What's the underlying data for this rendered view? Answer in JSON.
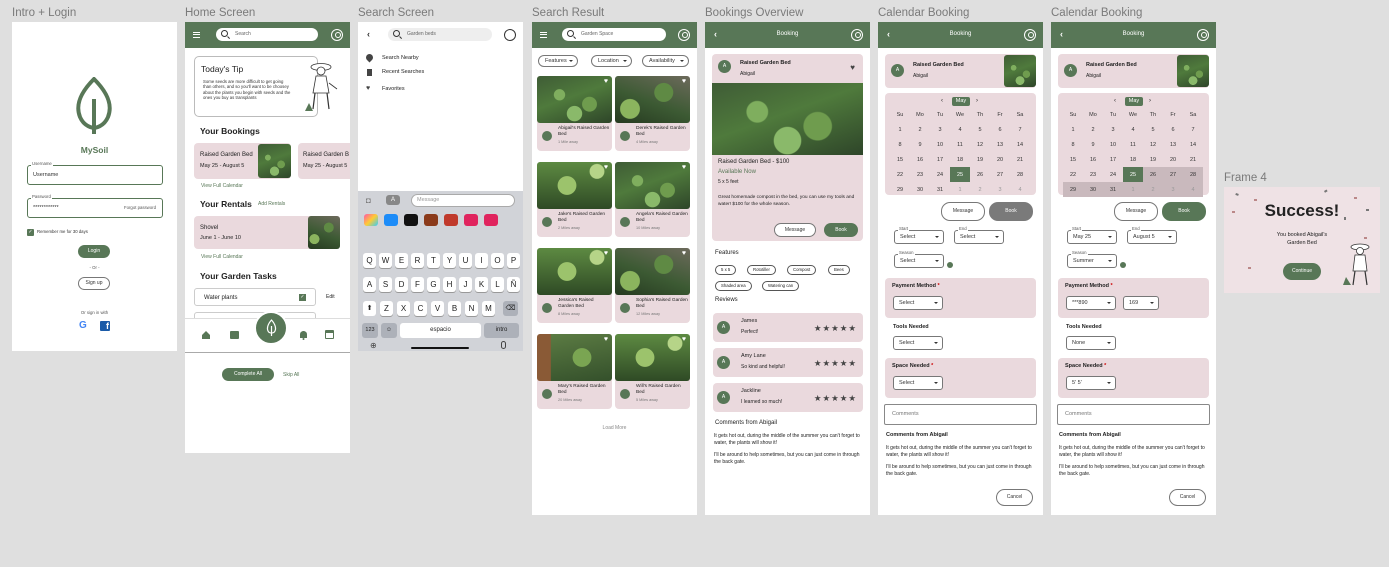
{
  "labels": {
    "intro": "Intro + Login",
    "home": "Home Screen",
    "search": "Search Screen",
    "result": "Search Result",
    "bookings": "Bookings Overview",
    "cal1": "Calendar Booking",
    "cal2": "Calendar Booking",
    "frame4": "Frame 4"
  },
  "intro": {
    "app_name": "MySoil",
    "username_caption": "Username",
    "username_value": "Username",
    "password_caption": "Password",
    "password_value": "************",
    "forgot": "Forgot password",
    "remember": "Remember me for 30 days",
    "login": "Login",
    "or": "- Or -",
    "signup": "Sign up",
    "or_sign_in": "Or sign in with"
  },
  "home": {
    "search_placeholder": "Search",
    "tip_title": "Today's Tip",
    "tip_text": "Some seeds are more difficult to get going than others, and so you'll want to be choosey about the plants you begin with seeds and the ones you buy as transplants",
    "bookings_title": "Your Bookings",
    "booking1_name": "Raised Garden Bed",
    "booking1_dates": "May 25 - August 5",
    "booking2_name": "Raised Garden B",
    "booking2_dates": "May 25 - August 5",
    "view_calendar": "View Full Calendar",
    "rentals_title": "Your Rentals",
    "add_rentals": "Add Rentals",
    "rental_name": "Shovel",
    "rental_dates": "June 1 - June 10",
    "view_calendar2": "View Full Calendar",
    "tasks_title": "Your Garden Tasks",
    "task1": "Water plants",
    "edit": "Edit",
    "complete_all": "Complete All",
    "skip_all": "Skip All"
  },
  "search": {
    "query": "Garden beds",
    "items": [
      "Search Nearby",
      "Recent Searches",
      "Favorites"
    ],
    "message_placeholder": "Message",
    "kb_row1": [
      "Q",
      "W",
      "E",
      "R",
      "T",
      "Y",
      "U",
      "I",
      "O",
      "P"
    ],
    "kb_row2": [
      "A",
      "S",
      "D",
      "F",
      "G",
      "H",
      "J",
      "K",
      "L",
      "Ñ"
    ],
    "kb_row3": [
      "Z",
      "X",
      "C",
      "V",
      "B",
      "N",
      "M"
    ],
    "kb_num": "123",
    "kb_space": "espacio",
    "kb_enter": "intro"
  },
  "result": {
    "query": "Garden Space",
    "filters": [
      "Features",
      "Location",
      "Availability"
    ],
    "cards": [
      {
        "name": "Abigail's Raised Garden Bed",
        "dist": "1 Mile away"
      },
      {
        "name": "Derek's Raised Garden Bed",
        "dist": "4 Miles away"
      },
      {
        "name": "Jake's Raised Garden Bed",
        "dist": "2 Miles away"
      },
      {
        "name": "Angela's Raised Garden Bed",
        "dist": "10 Miles away"
      },
      {
        "name": "Jessica's Raised Garden Bed",
        "dist": "8 Miles away"
      },
      {
        "name": "Sophia's Raised Garden Bed",
        "dist": "12 Miles away"
      },
      {
        "name": "Mary's Raised Garden Bed",
        "dist": "20 Miles away"
      },
      {
        "name": "Will's Raised Garden Bed",
        "dist": "5 Miles away"
      }
    ],
    "load_more": "Load More"
  },
  "bookings": {
    "title": "Booking",
    "listing_name": "Raised Garden Bed",
    "owner": "Abigail",
    "owner_initial": "A",
    "price_line": "Raised Garden Bed - $100",
    "available": "Available Now",
    "size": "5 x 5 feet",
    "desc": "Great homemade compost in the bed, you can use my tools and water! $100 for the whole season.",
    "message": "Message",
    "book": "Book",
    "features_title": "Features",
    "features": [
      "5 x 5",
      "Rototiller",
      "Compost",
      "Bees",
      "Shaded area",
      "Watering can"
    ],
    "reviews_title": "Reviews",
    "reviews": [
      {
        "initial": "A",
        "name": "James",
        "text": "Perfect!",
        "stars": "★★★★★"
      },
      {
        "initial": "A",
        "name": "Amy Lane",
        "text": "So kind and helpful!",
        "stars": "★★★★★"
      },
      {
        "initial": "A",
        "name": "Jackline",
        "text": "I learned so much!",
        "stars": "★★★★★"
      }
    ],
    "comments_title": "Comments from Abigail",
    "comment1": "It gets hot out, during the middle of the summer you can't forget to water, the plants will show it!",
    "comment2": "I'll be around to help sometimes, but you can just come in through the back gate."
  },
  "calendar": {
    "title": "Booking",
    "listing_name": "Raised Garden Bed",
    "owner": "Abigail",
    "owner_initial": "A",
    "month": "May",
    "days": [
      "Su",
      "Mo",
      "Tu",
      "We",
      "Th",
      "Fr",
      "Sa"
    ],
    "weeks": [
      [
        "1",
        "2",
        "3",
        "4",
        "5",
        "6",
        "7"
      ],
      [
        "8",
        "9",
        "10",
        "11",
        "12",
        "13",
        "14"
      ],
      [
        "15",
        "16",
        "17",
        "18",
        "19",
        "20",
        "21"
      ],
      [
        "22",
        "23",
        "24",
        "25",
        "26",
        "27",
        "28"
      ],
      [
        "29",
        "30",
        "31",
        "1",
        "2",
        "3",
        "4"
      ]
    ],
    "message": "Message",
    "book": "Book",
    "start_cap": "Start",
    "end_cap": "End",
    "season_cap": "Season",
    "placeholder": "Select",
    "payment": "Payment Method",
    "tools": "Tools Needed",
    "space": "Space Needed",
    "req": "*",
    "comments_placeholder": "Comments",
    "comments_title": "Comments from Abigail",
    "comment1": "It gets hot out, during the middle of the summer you can't forget to water, the plants will show it!",
    "comment2": "I'll be around to help sometimes, but you can just come in through the back gate.",
    "cancel": "Cancel"
  },
  "calendar2": {
    "start": "May 25",
    "end": "August 5",
    "season": "Summer",
    "card": "***890",
    "cvv": "169",
    "tools": "None",
    "space": "5' 5'"
  },
  "success": {
    "title": "Success!",
    "line": "You booked Abigail's Garden Bed",
    "continue": "Continue"
  },
  "colors": {
    "accent": "#587757",
    "pink": "#ead9dd"
  }
}
